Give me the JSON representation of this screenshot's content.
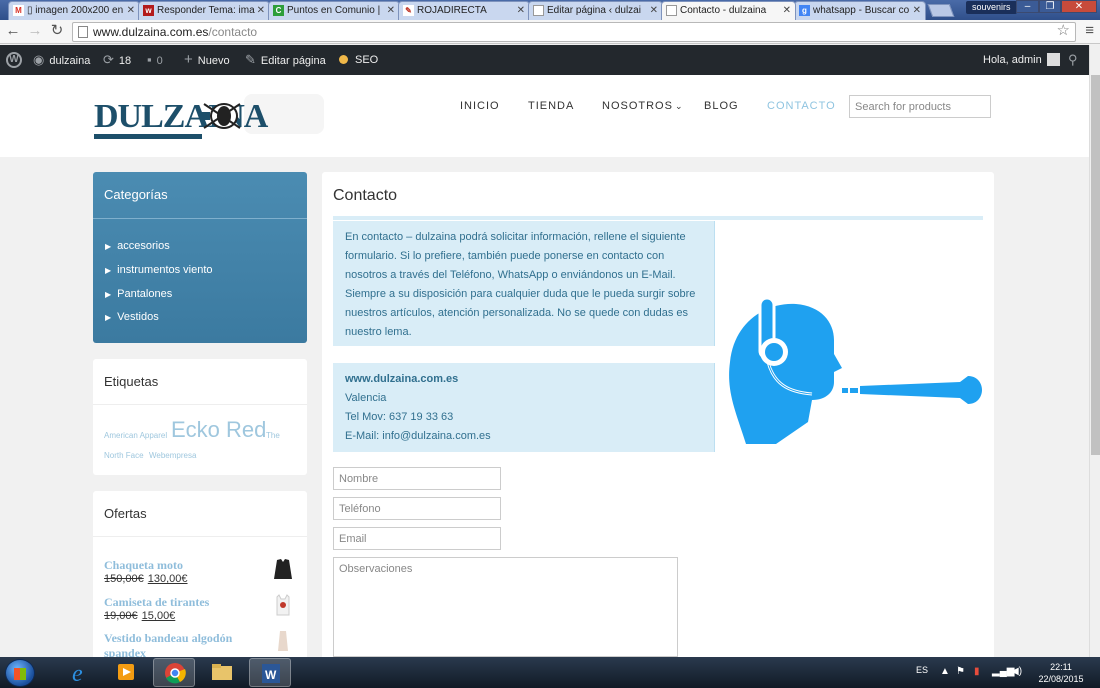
{
  "browser": {
    "tabs": [
      {
        "favicon": "M",
        "favicon_color": "#d93025",
        "label": "▯ imagen 200x200 en"
      },
      {
        "favicon": "w",
        "favicon_color": "#b31b1b",
        "label": "Responder Tema: ima"
      },
      {
        "favicon": "C",
        "favicon_color": "#2e9e3a",
        "label": "Puntos en Comunio | "
      },
      {
        "favicon": "✎",
        "favicon_color": "#c0392b",
        "label": "ROJADIRECTA"
      },
      {
        "favicon": "▯",
        "favicon_color": "#777777",
        "label": "Editar página ‹ dulzai"
      },
      {
        "favicon": "▯",
        "favicon_color": "#777777",
        "label": "Contacto - dulzaina"
      },
      {
        "favicon": "g",
        "favicon_color": "#4285f4",
        "label": "whatsapp - Buscar co"
      }
    ],
    "active_tab": 5,
    "window_label": "souvenirs",
    "url_domain": "www.dulzaina.com.es",
    "url_path": "/contacto"
  },
  "adminbar": {
    "site_name": "dulzaina",
    "updates_count": "18",
    "comments_count": "0",
    "new_label": "Nuevo",
    "edit_label": "Editar página",
    "seo_label": "SEO",
    "greeting": "Hola, admin"
  },
  "site": {
    "logo_text": "DULZAINA",
    "nav": [
      "INICIO",
      "TIENDA",
      "NOSOTROS",
      "BLOG",
      "CONTACTO"
    ],
    "active_nav": "CONTACTO",
    "search_placeholder": "Search for products"
  },
  "sidebar": {
    "categories_title": "Categorías",
    "categories": [
      "accesorios",
      "instrumentos viento",
      "Pantalones",
      "Vestidos"
    ],
    "tags_title": "Etiquetas",
    "tags": [
      "American Apparel",
      "Ecko Red",
      "The",
      "North Face",
      "Webempresa"
    ],
    "offers_title": "Ofertas",
    "offers": [
      {
        "name": "Chaqueta moto",
        "old_price": "150,00€",
        "new_price": "130,00€"
      },
      {
        "name": "Camiseta de tirantes",
        "old_price": "19,00€",
        "new_price": "15,00€"
      },
      {
        "name": "Vestido bandeau algodón",
        "name_line2": "spandex"
      }
    ]
  },
  "content": {
    "title": "Contacto",
    "intro": "En contacto – dulzaina podrá solicitar información, rellene el siguiente formulario. Si lo prefiere, también puede ponerse en contacto con nosotros a través del Teléfono, WhatsApp o enviándonos un E-Mail. Siempre a su disposición para cualquier duda que le pueda surgir sobre nuestros artículos, atención personalizada. No se quede con dudas es nuestro lema.",
    "contact_site": "www.dulzaina.com.es",
    "contact_city": "Valencia",
    "contact_phone": "Tel Mov: 637 19 33 63",
    "contact_email": "E-Mail: info@dulzaina.com.es",
    "form": {
      "name_placeholder": "Nombre",
      "phone_placeholder": "Teléfono",
      "email_placeholder": "Email",
      "notes_placeholder": "Observaciones"
    }
  },
  "taskbar": {
    "language": "ES",
    "time": "22:11",
    "date": "22/08/2015"
  }
}
